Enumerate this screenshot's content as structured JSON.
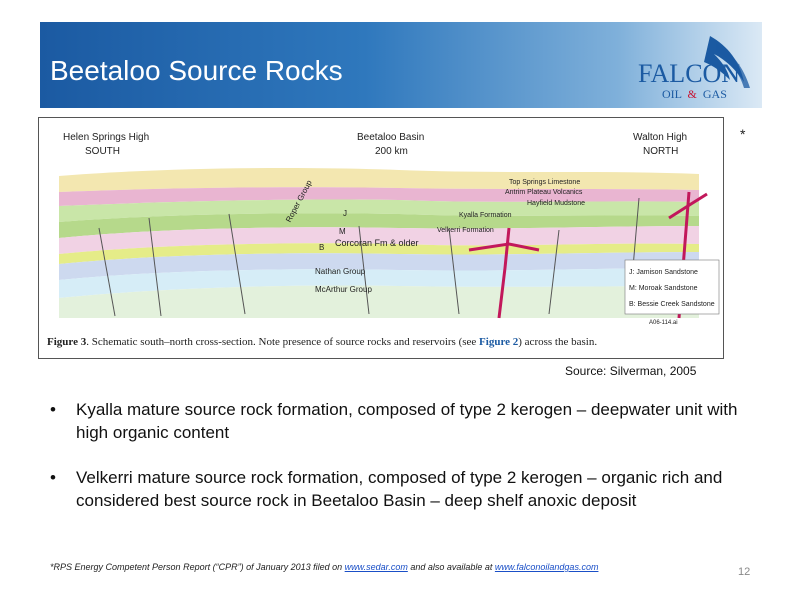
{
  "slide": {
    "title": "Beetaloo Source Rocks",
    "asterisk": "*",
    "page_number": "12"
  },
  "logo": {
    "word": "FALCON",
    "sub_oil": "OIL",
    "sub_amp": "&",
    "sub_gas": "GAS",
    "brand_color": "#1b5aa2"
  },
  "figure": {
    "left_label_1": "Helen Springs High",
    "left_label_2": "SOUTH",
    "center_label_1": "Beetaloo Basin",
    "center_label_2": "200 km",
    "right_label_1": "Walton High",
    "right_label_2": "NORTH",
    "layers": {
      "top_springs": "Top Springs Limestone",
      "antrim": "Antrim Plateau Volcanics",
      "hayfield": "Hayfield Mudstone",
      "kyalla": "Kyalla Formation",
      "velkerri": "Velkerri Formation",
      "corcoran": "Corcoran Fm & older",
      "nathan": "Nathan Group",
      "mcarthur": "McArthur Group",
      "roper": "Roper Group",
      "j": "J",
      "m": "M",
      "b": "B"
    },
    "legend": [
      "J: Jamison Sandstone",
      "M: Moroak Sandstone",
      "B: Bessie Creek Sandstone"
    ],
    "code": "A06-114.ai",
    "caption_prefix": "Figure 3",
    "caption_text": ". Schematic south–north cross-section. Note presence of source rocks and reservoirs (see ",
    "caption_link": "Figure 2",
    "caption_suffix": ") across the basin."
  },
  "source": "Source: Silverman, 2005",
  "bullets": [
    "Kyalla mature source rock formation, composed of type 2 kerogen – deepwater unit with high organic content",
    "Velkerri mature source rock formation, composed of type 2 kerogen – organic rich and considered best source rock in Beetaloo Basin – deep shelf anoxic deposit"
  ],
  "bullet_symbol": "•",
  "footnote": {
    "text_1": "*RPS Energy Competent Person Report (“CPR”) of January 2013 filed on ",
    "link_1": "www.sedar.com",
    "text_2": " and also available at ",
    "link_2": "www.falconoilandgas.com"
  }
}
